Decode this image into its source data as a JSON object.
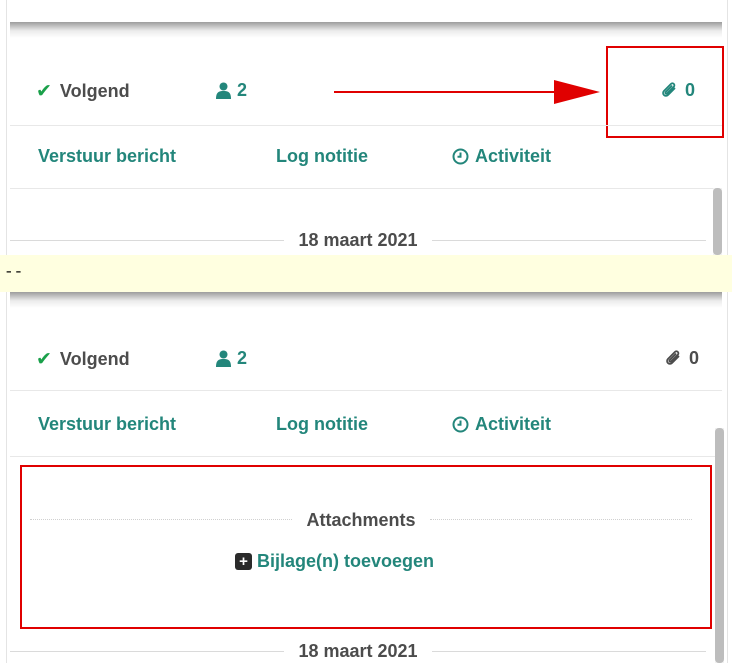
{
  "top": {
    "follow_label": "Volgend",
    "followers_count": "2",
    "attachments_count": "0",
    "actions": {
      "send_message": "Verstuur bericht",
      "log_note": "Log notitie",
      "activity": "Activiteit"
    },
    "date": "18 maart 2021"
  },
  "divider_text": "--",
  "bottom": {
    "follow_label": "Volgend",
    "followers_count": "2",
    "attachments_count": "0",
    "actions": {
      "send_message": "Verstuur bericht",
      "log_note": "Log notitie",
      "activity": "Activiteit"
    },
    "attachments_title": "Attachments",
    "add_attachment": "Bijlage(n) toevoegen",
    "date": "18 maart 2021"
  },
  "colors": {
    "accent": "#23867b",
    "check": "#1aa04a",
    "annotation": "#e00000",
    "divider_bg": "#ffffe0"
  },
  "icons": [
    "check-icon",
    "user-icon",
    "paperclip-icon",
    "clock-icon",
    "plus-square-icon"
  ]
}
